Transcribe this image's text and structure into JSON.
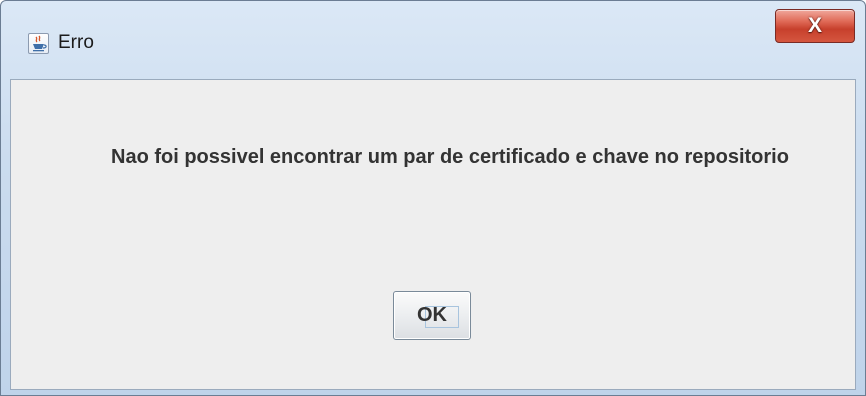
{
  "window": {
    "title": "Erro",
    "icon": "java-coffee-cup-icon",
    "close_glyph": "X"
  },
  "dialog": {
    "message": "Nao foi possivel encontrar um par de certificado e chave no repositorio",
    "ok_label": "OK"
  },
  "colors": {
    "close_button": "#c7402c",
    "dialog_background": "#eeeeee",
    "titlebar": "#cbdcef"
  }
}
